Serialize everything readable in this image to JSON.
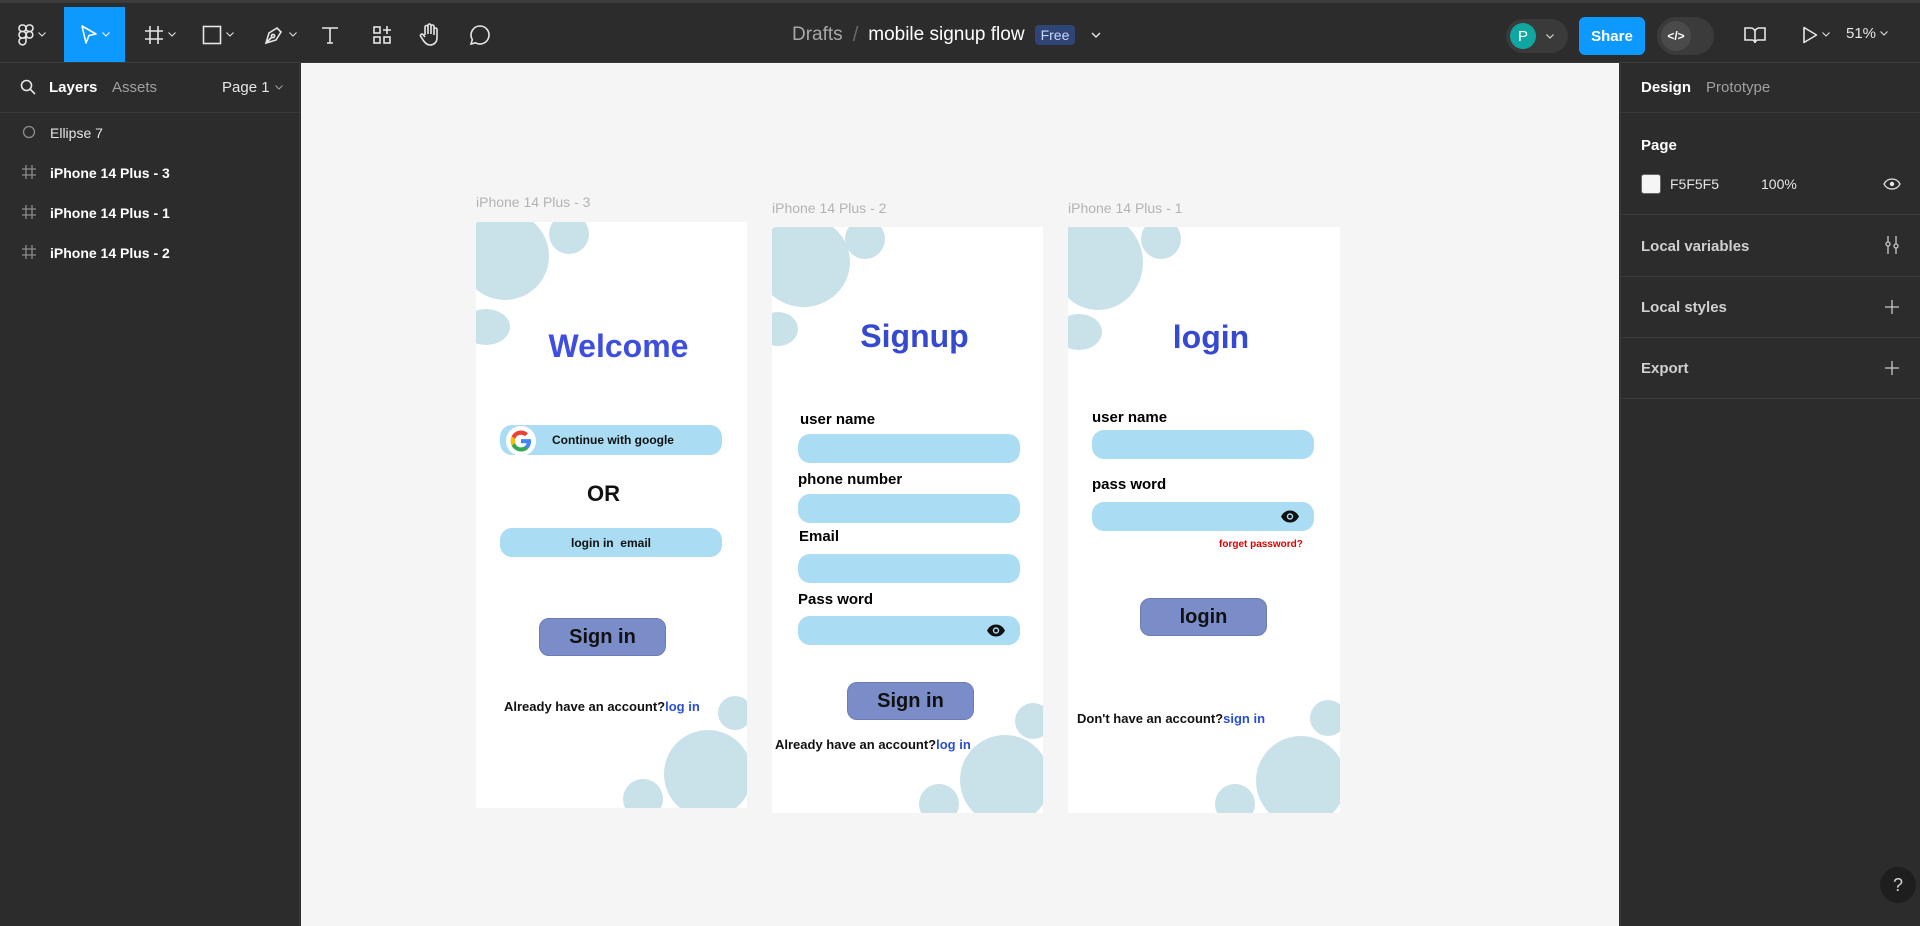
{
  "toolbar": {
    "breadcrumb_project": "Drafts",
    "breadcrumb_sep": "/",
    "file_name": "mobile signup flow",
    "plan_badge": "Free",
    "avatar_initial": "P",
    "share_label": "Share",
    "zoom": "51%",
    "icons": [
      "figma-menu-icon",
      "move-tool-icon",
      "frame-tool-icon",
      "shape-tool-icon",
      "pen-tool-icon",
      "text-tool-icon",
      "resources-icon",
      "hand-tool-icon",
      "comment-icon",
      "dev-mode-icon",
      "library-icon",
      "present-icon"
    ]
  },
  "left_panel": {
    "tab_layers": "Layers",
    "tab_assets": "Assets",
    "page_selector": "Page 1",
    "layers": [
      {
        "name": "Ellipse 7",
        "icon": "ellipse-icon"
      },
      {
        "name": "iPhone 14 Plus - 3",
        "icon": "frame-icon"
      },
      {
        "name": "iPhone 14 Plus - 1",
        "icon": "frame-icon"
      },
      {
        "name": "iPhone 14 Plus - 2",
        "icon": "frame-icon"
      }
    ]
  },
  "canvas": {
    "background": "#F5F5F5",
    "frames": {
      "welcome": {
        "label": "iPhone 14 Plus - 3",
        "title": "Welcome",
        "google_button": "Continue with google",
        "or_text": "OR",
        "email_button": "login in  email",
        "signin_button": "Sign in",
        "footer_text": "Already have an account?",
        "footer_link": "log in"
      },
      "signup": {
        "label": "iPhone 14 Plus - 2",
        "title": "Signup",
        "field_username": "user name",
        "field_phone": "phone number",
        "field_email": "Email",
        "field_password": "Pass word",
        "signin_button": "Sign in",
        "footer_text": "Already have an account?",
        "footer_link": "log in"
      },
      "login": {
        "label": "iPhone 14 Plus - 1",
        "title": "login",
        "field_username": "user name",
        "field_password": "pass word",
        "forgot_link": "forget password?",
        "login_button": "login",
        "footer_text": "Don't have an account?",
        "footer_link": "sign in"
      }
    }
  },
  "right_panel": {
    "tab_design": "Design",
    "tab_prototype": "Prototype",
    "page_heading": "Page",
    "page_color": "F5F5F5",
    "page_opacity": "100%",
    "local_variables": "Local variables",
    "local_styles": "Local styles",
    "export": "Export",
    "help": "?"
  },
  "colors": {
    "accent": "#0d99ff",
    "title_blue": "#3d4ee0",
    "pill_fill": "#aadcf3",
    "button_fill": "#7b8dc9",
    "bubble": "#c9e1e9",
    "forgot_red": "#e00000"
  }
}
